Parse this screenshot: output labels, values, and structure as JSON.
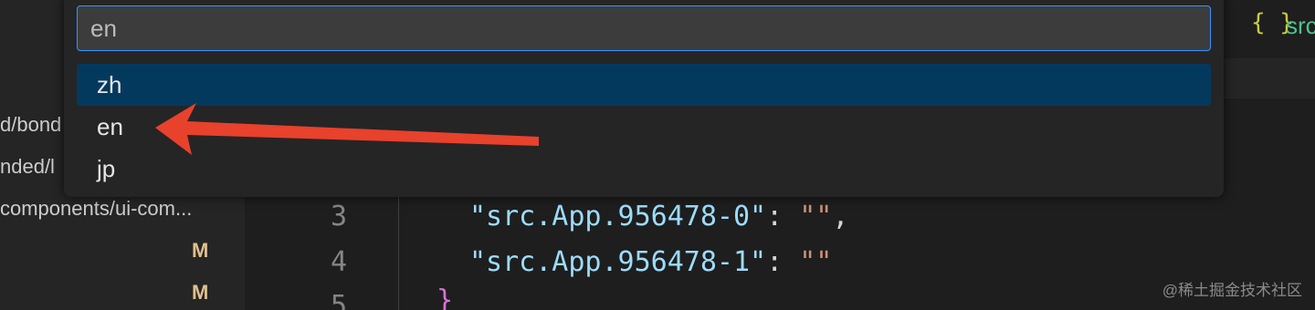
{
  "quick_pick": {
    "input_value": "en",
    "items": [
      {
        "label": "zh",
        "selected": true
      },
      {
        "label": "en",
        "selected": false
      },
      {
        "label": "jp",
        "selected": false
      }
    ]
  },
  "editor_tab": {
    "icon": "json-braces-icon",
    "braces": "{ }",
    "label": "src"
  },
  "sidebar": {
    "rows": [
      "d/bond",
      "nded/l",
      "components/ui-com..."
    ],
    "badges": [
      "M",
      "M"
    ]
  },
  "editor": {
    "line_numbers": [
      "3",
      "4",
      "5"
    ],
    "lines": [
      {
        "key": "\"src.App.956478-0\"",
        "colon": ": ",
        "value": "\"\"",
        "trail": ","
      },
      {
        "key": "\"src.App.956478-1\"",
        "colon": ": ",
        "value": "\"\"",
        "trail": ""
      }
    ],
    "closing_brace": "}"
  },
  "watermark": "@稀土掘金技术社区",
  "colors": {
    "annotation_arrow": "#e8412c",
    "selection": "#04395e",
    "focus_border": "#3794ff"
  }
}
